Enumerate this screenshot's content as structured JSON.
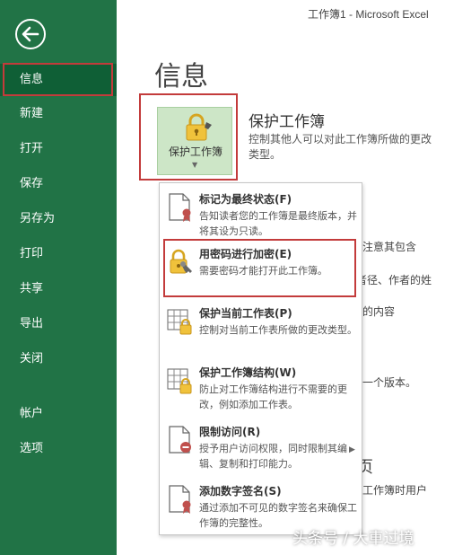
{
  "window": {
    "title": "工作簿1 - Microsoft Excel"
  },
  "sidebar": {
    "back_icon": "back-arrow-icon",
    "items": [
      {
        "label": "信息",
        "active": true
      },
      {
        "label": "新建"
      },
      {
        "label": "打开"
      },
      {
        "label": "保存"
      },
      {
        "label": "另存为"
      },
      {
        "label": "打印"
      },
      {
        "label": "共享"
      },
      {
        "label": "导出"
      },
      {
        "label": "关闭"
      },
      {
        "label": "帐户"
      },
      {
        "label": "选项"
      }
    ]
  },
  "main": {
    "title": "信息",
    "protect_tile": {
      "label": "保护工作簿",
      "icon": "lock-icon"
    },
    "protect_section": {
      "heading": "保护工作簿",
      "description": "控制其他人可以对此工作簿所做的更改类型。"
    },
    "background_fragments": [
      "注意其包含",
      "者径、作者的姓",
      "的内容",
      "一个版本。",
      "页",
      "工作簿时用户"
    ]
  },
  "dropdown": {
    "items": [
      {
        "title": "标记为最终状态(F)",
        "description": "告知读者您的工作簿是最终版本，并将其设为只读。",
        "icon": "document-ribbon-icon"
      },
      {
        "title": "用密码进行加密(E)",
        "description": "需要密码才能打开此工作簿。",
        "icon": "lock-key-icon"
      },
      {
        "title": "保护当前工作表(P)",
        "description": "控制对当前工作表所做的更改类型。",
        "icon": "sheet-lock-icon"
      },
      {
        "title": "保护工作簿结构(W)",
        "description": "防止对工作簿结构进行不需要的更改，例如添加工作表。",
        "icon": "workbook-lock-icon"
      },
      {
        "title": "限制访问(R)",
        "description": "授予用户访问权限，同时限制其编辑、复制和打印能力。",
        "icon": "restrict-access-icon",
        "has_submenu": true
      },
      {
        "title": "添加数字签名(S)",
        "description": "通过添加不可见的数字签名来确保工作簿的完整性。",
        "icon": "signature-ribbon-icon"
      }
    ]
  },
  "watermark": "头条号 / 大車过境",
  "colors": {
    "sidebar": "#217346",
    "highlight_box": "#c33b3b",
    "tile": "#cde6c7"
  }
}
